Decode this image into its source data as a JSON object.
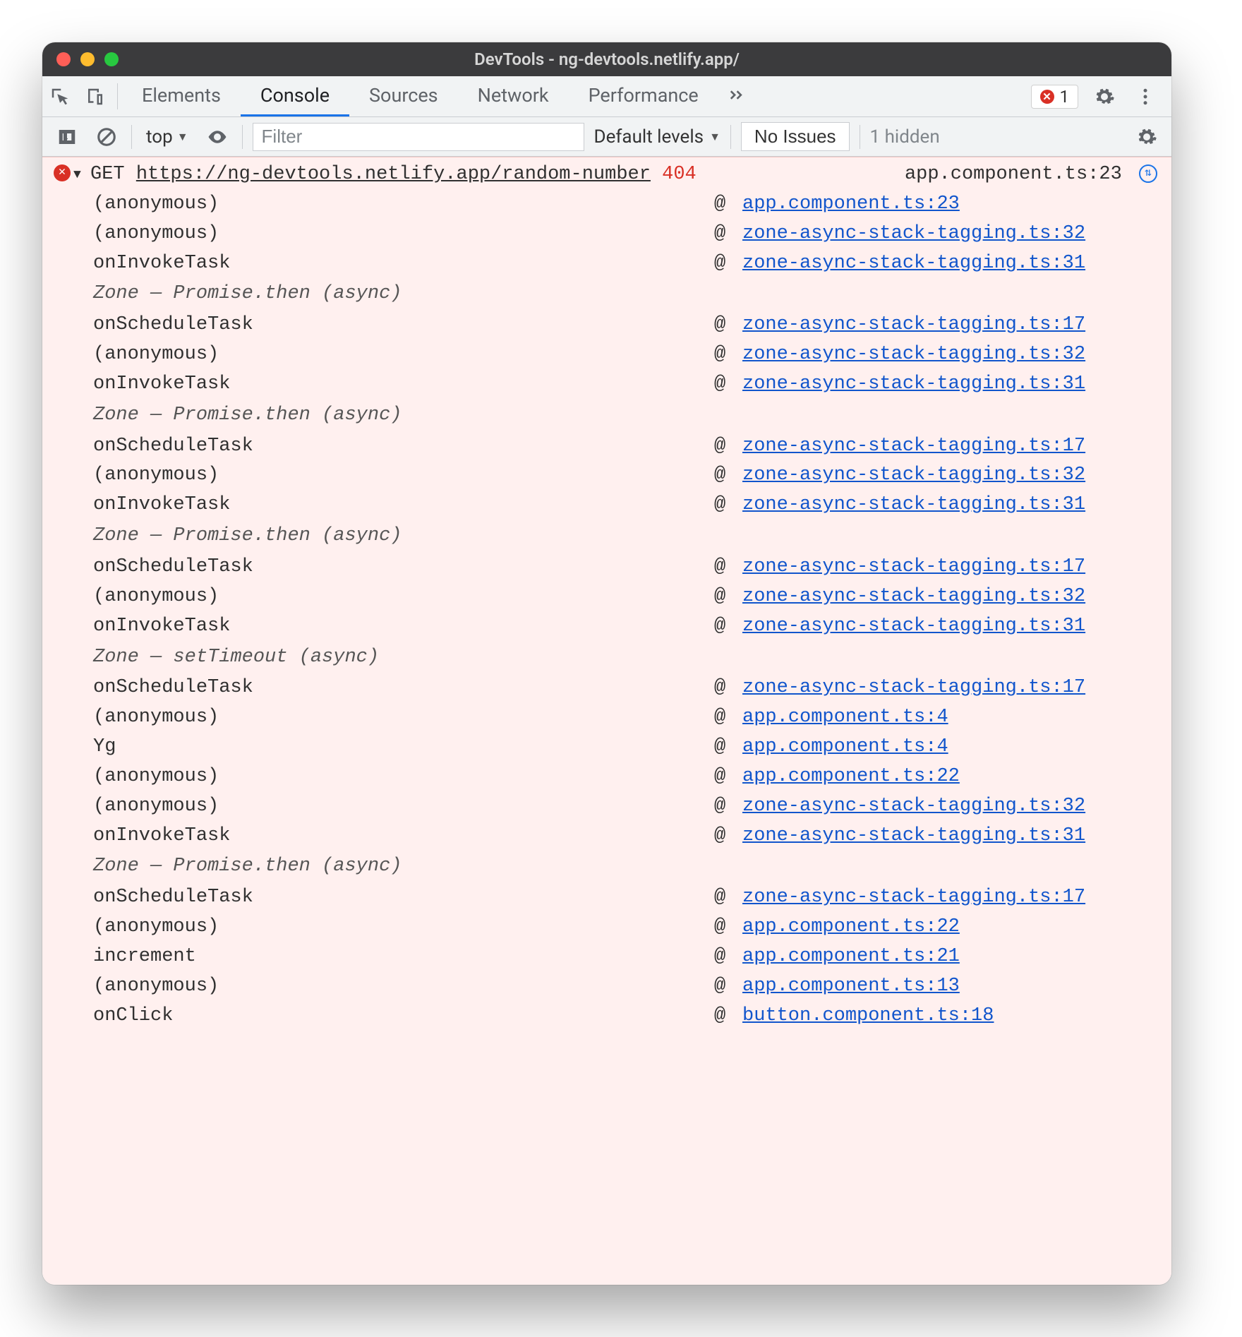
{
  "window": {
    "title": "DevTools - ng-devtools.netlify.app/"
  },
  "tabs": {
    "elements": "Elements",
    "console": "Console",
    "sources": "Sources",
    "network": "Network",
    "performance": "Performance",
    "error_count": "1"
  },
  "toolbar": {
    "context": "top",
    "filter_placeholder": "Filter",
    "levels_label": "Default levels",
    "issues_label": "No Issues",
    "hidden_label": "1 hidden"
  },
  "log": {
    "method": "GET",
    "url": "https://ng-devtools.netlify.app/random-number",
    "status": "404",
    "source_inline": "app.component.ts:23",
    "frames": [
      {
        "type": "frame",
        "fn": "(anonymous)",
        "loc": "app.component.ts:23"
      },
      {
        "type": "frame",
        "fn": "(anonymous)",
        "loc": "zone-async-stack-tagging.ts:32"
      },
      {
        "type": "frame",
        "fn": "onInvokeTask",
        "loc": "zone-async-stack-tagging.ts:31"
      },
      {
        "type": "async",
        "label": "Zone — Promise.then (async)"
      },
      {
        "type": "frame",
        "fn": "onScheduleTask",
        "loc": "zone-async-stack-tagging.ts:17"
      },
      {
        "type": "frame",
        "fn": "(anonymous)",
        "loc": "zone-async-stack-tagging.ts:32"
      },
      {
        "type": "frame",
        "fn": "onInvokeTask",
        "loc": "zone-async-stack-tagging.ts:31"
      },
      {
        "type": "async",
        "label": "Zone — Promise.then (async)"
      },
      {
        "type": "frame",
        "fn": "onScheduleTask",
        "loc": "zone-async-stack-tagging.ts:17"
      },
      {
        "type": "frame",
        "fn": "(anonymous)",
        "loc": "zone-async-stack-tagging.ts:32"
      },
      {
        "type": "frame",
        "fn": "onInvokeTask",
        "loc": "zone-async-stack-tagging.ts:31"
      },
      {
        "type": "async",
        "label": "Zone — Promise.then (async)"
      },
      {
        "type": "frame",
        "fn": "onScheduleTask",
        "loc": "zone-async-stack-tagging.ts:17"
      },
      {
        "type": "frame",
        "fn": "(anonymous)",
        "loc": "zone-async-stack-tagging.ts:32"
      },
      {
        "type": "frame",
        "fn": "onInvokeTask",
        "loc": "zone-async-stack-tagging.ts:31"
      },
      {
        "type": "async",
        "label": "Zone — setTimeout (async)"
      },
      {
        "type": "frame",
        "fn": "onScheduleTask",
        "loc": "zone-async-stack-tagging.ts:17"
      },
      {
        "type": "frame",
        "fn": "(anonymous)",
        "loc": "app.component.ts:4"
      },
      {
        "type": "frame",
        "fn": "Yg",
        "loc": "app.component.ts:4"
      },
      {
        "type": "frame",
        "fn": "(anonymous)",
        "loc": "app.component.ts:22"
      },
      {
        "type": "frame",
        "fn": "(anonymous)",
        "loc": "zone-async-stack-tagging.ts:32"
      },
      {
        "type": "frame",
        "fn": "onInvokeTask",
        "loc": "zone-async-stack-tagging.ts:31"
      },
      {
        "type": "async",
        "label": "Zone — Promise.then (async)"
      },
      {
        "type": "frame",
        "fn": "onScheduleTask",
        "loc": "zone-async-stack-tagging.ts:17"
      },
      {
        "type": "frame",
        "fn": "(anonymous)",
        "loc": "app.component.ts:22"
      },
      {
        "type": "frame",
        "fn": "increment",
        "loc": "app.component.ts:21"
      },
      {
        "type": "frame",
        "fn": "(anonymous)",
        "loc": "app.component.ts:13"
      },
      {
        "type": "frame",
        "fn": "onClick",
        "loc": "button.component.ts:18"
      }
    ]
  }
}
